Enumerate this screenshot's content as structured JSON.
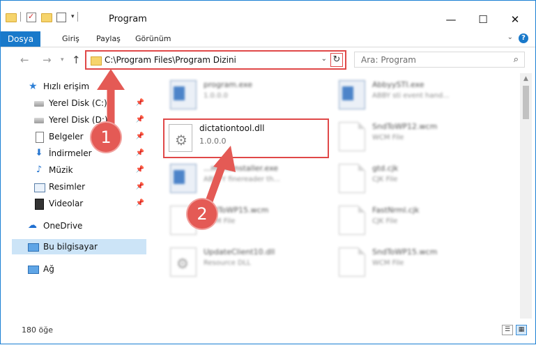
{
  "window": {
    "title": "Program",
    "minimize": "—",
    "maximize": "☐",
    "close": "✕"
  },
  "ribbon": {
    "file_tab": "Dosya",
    "tabs": [
      "Giriş",
      "Paylaş",
      "Görünüm"
    ],
    "help": "?"
  },
  "address": {
    "path": "C:\\Program Files\\Program Dizini",
    "back": "←",
    "forward": "→",
    "up": "↑",
    "refresh": "↻"
  },
  "search": {
    "placeholder": "Ara: Program"
  },
  "nav_pane": {
    "quick_access": "Hızlı erişim",
    "items": [
      {
        "label": "Yerel Disk (C:)",
        "icon": "disk-icon"
      },
      {
        "label": "Yerel Disk (D:)",
        "icon": "disk-icon"
      },
      {
        "label": "Belgeler",
        "icon": "documents-icon"
      },
      {
        "label": "İndirmeler",
        "icon": "downloads-icon"
      },
      {
        "label": "Müzik",
        "icon": "music-icon"
      },
      {
        "label": "Resimler",
        "icon": "pictures-icon"
      },
      {
        "label": "Videolar",
        "icon": "videos-icon"
      }
    ],
    "onedrive": "OneDrive",
    "this_pc": "Bu bilgisayar",
    "network": "Ağ"
  },
  "files": {
    "left": [
      {
        "name": "program.exe",
        "sub": "1.0.0.0"
      },
      {
        "name": "dictationtool.dll",
        "sub": "1.0.0.0"
      },
      {
        "name": "...monsInstaller.exe",
        "sub": "ABBYY finereader th..."
      },
      {
        "name": "SndToWP15.wcm",
        "sub": "WCM File"
      },
      {
        "name": "UpdateClient10.dll",
        "sub": "Resource DLL"
      }
    ],
    "right": [
      {
        "name": "AbbyySTI.exe",
        "sub": "ABBY sti event hand..."
      },
      {
        "name": "SndToWP12.wcm",
        "sub": "WCM File"
      },
      {
        "name": "gtd.cjk",
        "sub": "CJK File"
      },
      {
        "name": "FastNrml.cjk",
        "sub": "CJK File"
      },
      {
        "name": "SndToWP15.wcm",
        "sub": "WCM File"
      }
    ]
  },
  "markers": [
    "1",
    "2"
  ],
  "status": {
    "count": "180 öğe"
  }
}
